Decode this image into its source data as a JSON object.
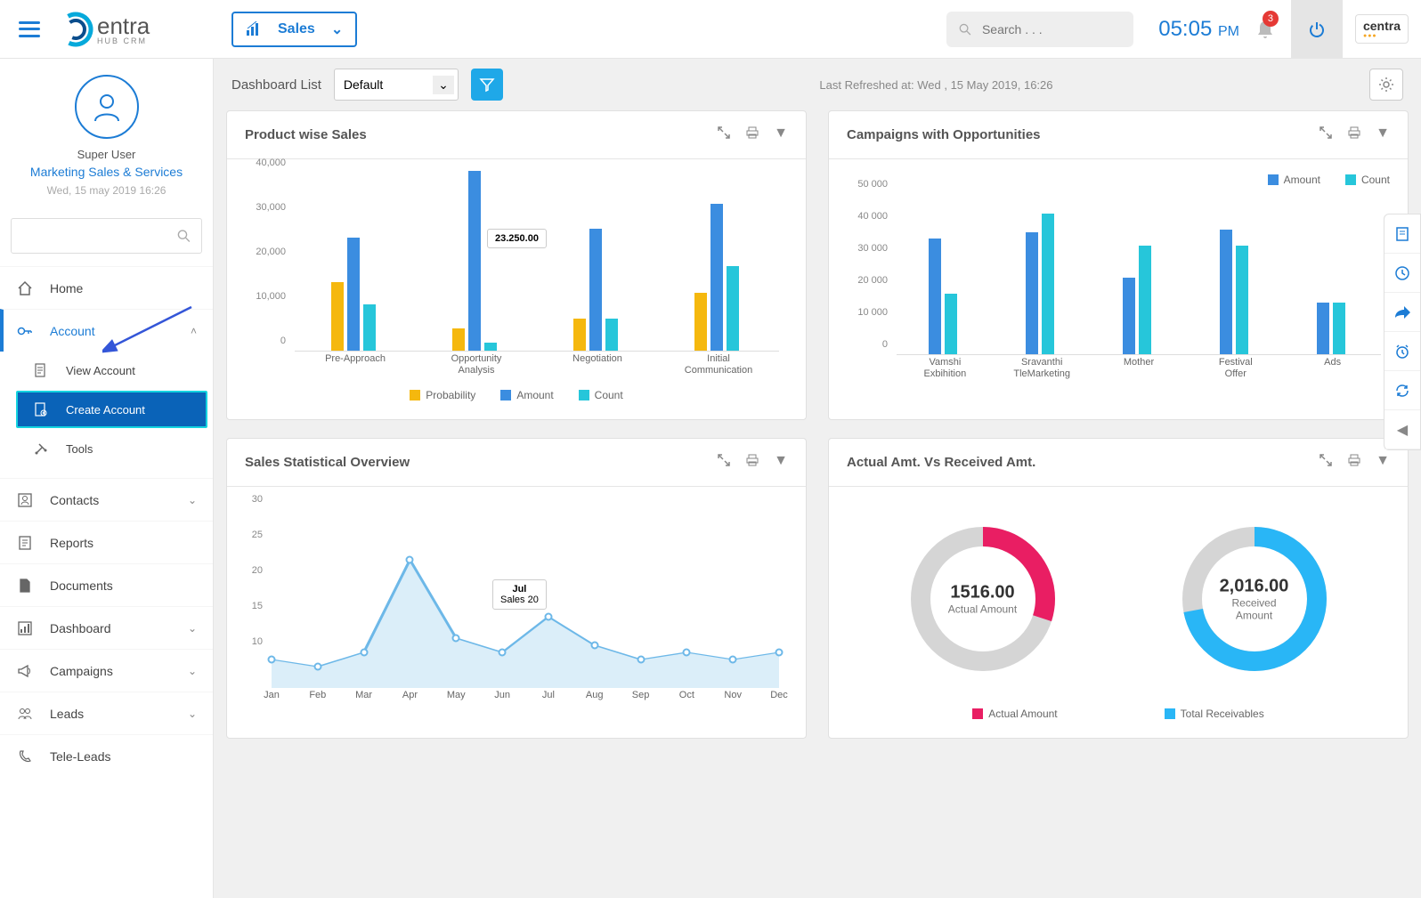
{
  "header": {
    "module": "Sales",
    "search_placeholder": "Search . . .",
    "time": "05:05",
    "ampm": "PM",
    "notif_count": "3",
    "brand": "centra"
  },
  "user": {
    "name": "Super User",
    "dept": "Marketing Sales & Services",
    "date": "Wed, 15 may 2019 16:26"
  },
  "nav": {
    "home": "Home",
    "account": "Account",
    "view_account": "View Account",
    "create_account": "Create Account",
    "tools": "Tools",
    "contacts": "Contacts",
    "reports": "Reports",
    "documents": "Documents",
    "dashboard": "Dashboard",
    "campaigns": "Campaigns",
    "leads": "Leads",
    "teleleads": "Tele-Leads"
  },
  "dashbar": {
    "label": "Dashboard List",
    "selected": "Default",
    "refreshed": "Last Refreshed at: Wed , 15 May 2019, 16:26"
  },
  "widgets": {
    "product_sales": "Product wise Sales",
    "campaigns_opp": "Campaigns with Opportunities",
    "sales_overview": "Sales Statistical Overview",
    "actual_vs_received": "Actual Amt. Vs Received Amt."
  },
  "chart_data": [
    {
      "type": "bar",
      "title": "Product wise Sales",
      "categories": [
        "Pre-Approach",
        "Opportunity Analysis",
        "Negotiation",
        "Initial Communication"
      ],
      "series": [
        {
          "name": "Probability",
          "values": [
            15500,
            5000,
            7200,
            13000
          ],
          "color": "#f5b80e"
        },
        {
          "name": "Amount",
          "values": [
            25500,
            40500,
            27500,
            33000
          ],
          "color": "#3b8de0"
        },
        {
          "name": "Count",
          "values": [
            10500,
            1800,
            7200,
            19000
          ],
          "color": "#26c6da"
        }
      ],
      "ylim": [
        0,
        40000
      ],
      "y_ticks": [
        0,
        10000,
        20000,
        30000,
        40000
      ],
      "tooltip": "23.250.00"
    },
    {
      "type": "bar",
      "title": "Campaigns with Opportunities",
      "categories": [
        "Vamshi Exbihition",
        "Sravanthi TleMarketing",
        "Mother",
        "Festival Offer",
        "Ads"
      ],
      "series": [
        {
          "name": "Amount",
          "values": [
            36000,
            38000,
            24000,
            39000,
            16000
          ],
          "color": "#3b8de0"
        },
        {
          "name": "Count",
          "values": [
            19000,
            44000,
            34000,
            34000,
            16000
          ],
          "color": "#26c6da"
        }
      ],
      "ylim": [
        0,
        50000
      ],
      "y_ticks": [
        0,
        10000,
        20000,
        30000,
        40000,
        50000
      ]
    },
    {
      "type": "area",
      "title": "Sales Statistical Overview",
      "x": [
        "Jan",
        "Feb",
        "Mar",
        "Apr",
        "May",
        "Jun",
        "Jul",
        "Aug",
        "Sep",
        "Oct",
        "Nov",
        "Dec"
      ],
      "values": [
        9,
        8,
        10,
        23,
        12,
        10,
        15,
        11,
        9,
        10,
        9,
        10
      ],
      "ylim": [
        5,
        30
      ],
      "y_ticks": [
        10,
        15,
        20,
        25,
        30
      ],
      "tooltip": {
        "label": "Jul",
        "value": "Sales 20"
      }
    },
    {
      "type": "pie",
      "title": "Actual Amt. Vs Received Amt.",
      "donuts": [
        {
          "value": "1516.00",
          "label": "Actual Amount",
          "legend": "Actual Amount",
          "color": "#e91e63",
          "fraction": 0.3
        },
        {
          "value": "2,016.00",
          "label": "Received Amount",
          "legend": "Total Receivables",
          "color": "#29b6f6",
          "fraction": 0.72
        }
      ]
    }
  ],
  "legends": {
    "prob": "Probability",
    "amount": "Amount",
    "count": "Count",
    "actual": "Actual Amount",
    "receivables": "Total Receivables"
  },
  "colors": {
    "yellow": "#f5b80e",
    "blue": "#3b8de0",
    "teal": "#26c6da",
    "pink": "#e91e63",
    "lightblue": "#29b6f6",
    "gray": "#d0d0d0"
  }
}
